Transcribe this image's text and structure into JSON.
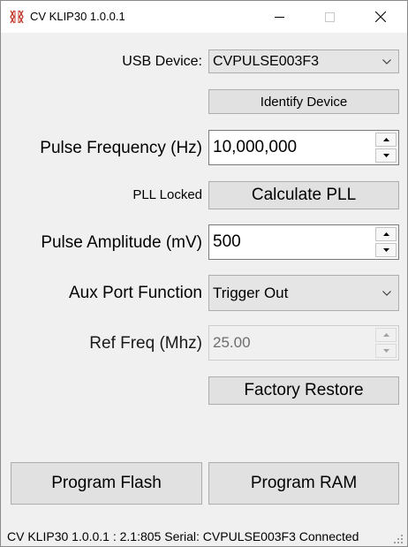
{
  "window": {
    "title": "CV KLIP30 1.0.0.1"
  },
  "usb_device": {
    "label": "USB Device:",
    "selected": "CVPULSE003F3"
  },
  "identify_button": "Identify Device",
  "pulse_frequency": {
    "label": "Pulse Frequency (Hz)",
    "value": "10,000,000"
  },
  "pll": {
    "status": "PLL Locked",
    "button": "Calculate PLL"
  },
  "pulse_amplitude": {
    "label": "Pulse Amplitude (mV)",
    "value": "500"
  },
  "aux_port": {
    "label": "Aux Port Function",
    "selected": "Trigger Out"
  },
  "ref_freq": {
    "label": "Ref Freq (Mhz)",
    "value": "25.00",
    "enabled": false
  },
  "factory_restore_button": "Factory Restore",
  "program_flash_button": "Program Flash",
  "program_ram_button": "Program RAM",
  "status_bar": "CV KLIP30 1.0.0.1 :  2.1:805 Serial: CVPULSE003F3 Connected",
  "icons": {
    "app": "app-icon",
    "minimize": "minimize-icon",
    "maximize": "maximize-icon",
    "close": "close-icon",
    "dropdown": "chevron-down-icon",
    "spin_up": "spin-up-icon",
    "spin_down": "spin-down-icon",
    "resize": "resize-grip-icon"
  },
  "colors": {
    "app_icon": "#c0392b",
    "window_bg": "#f0f0f0",
    "button_bg": "#e1e1e1",
    "combo_bg": "#e5e5e5"
  }
}
